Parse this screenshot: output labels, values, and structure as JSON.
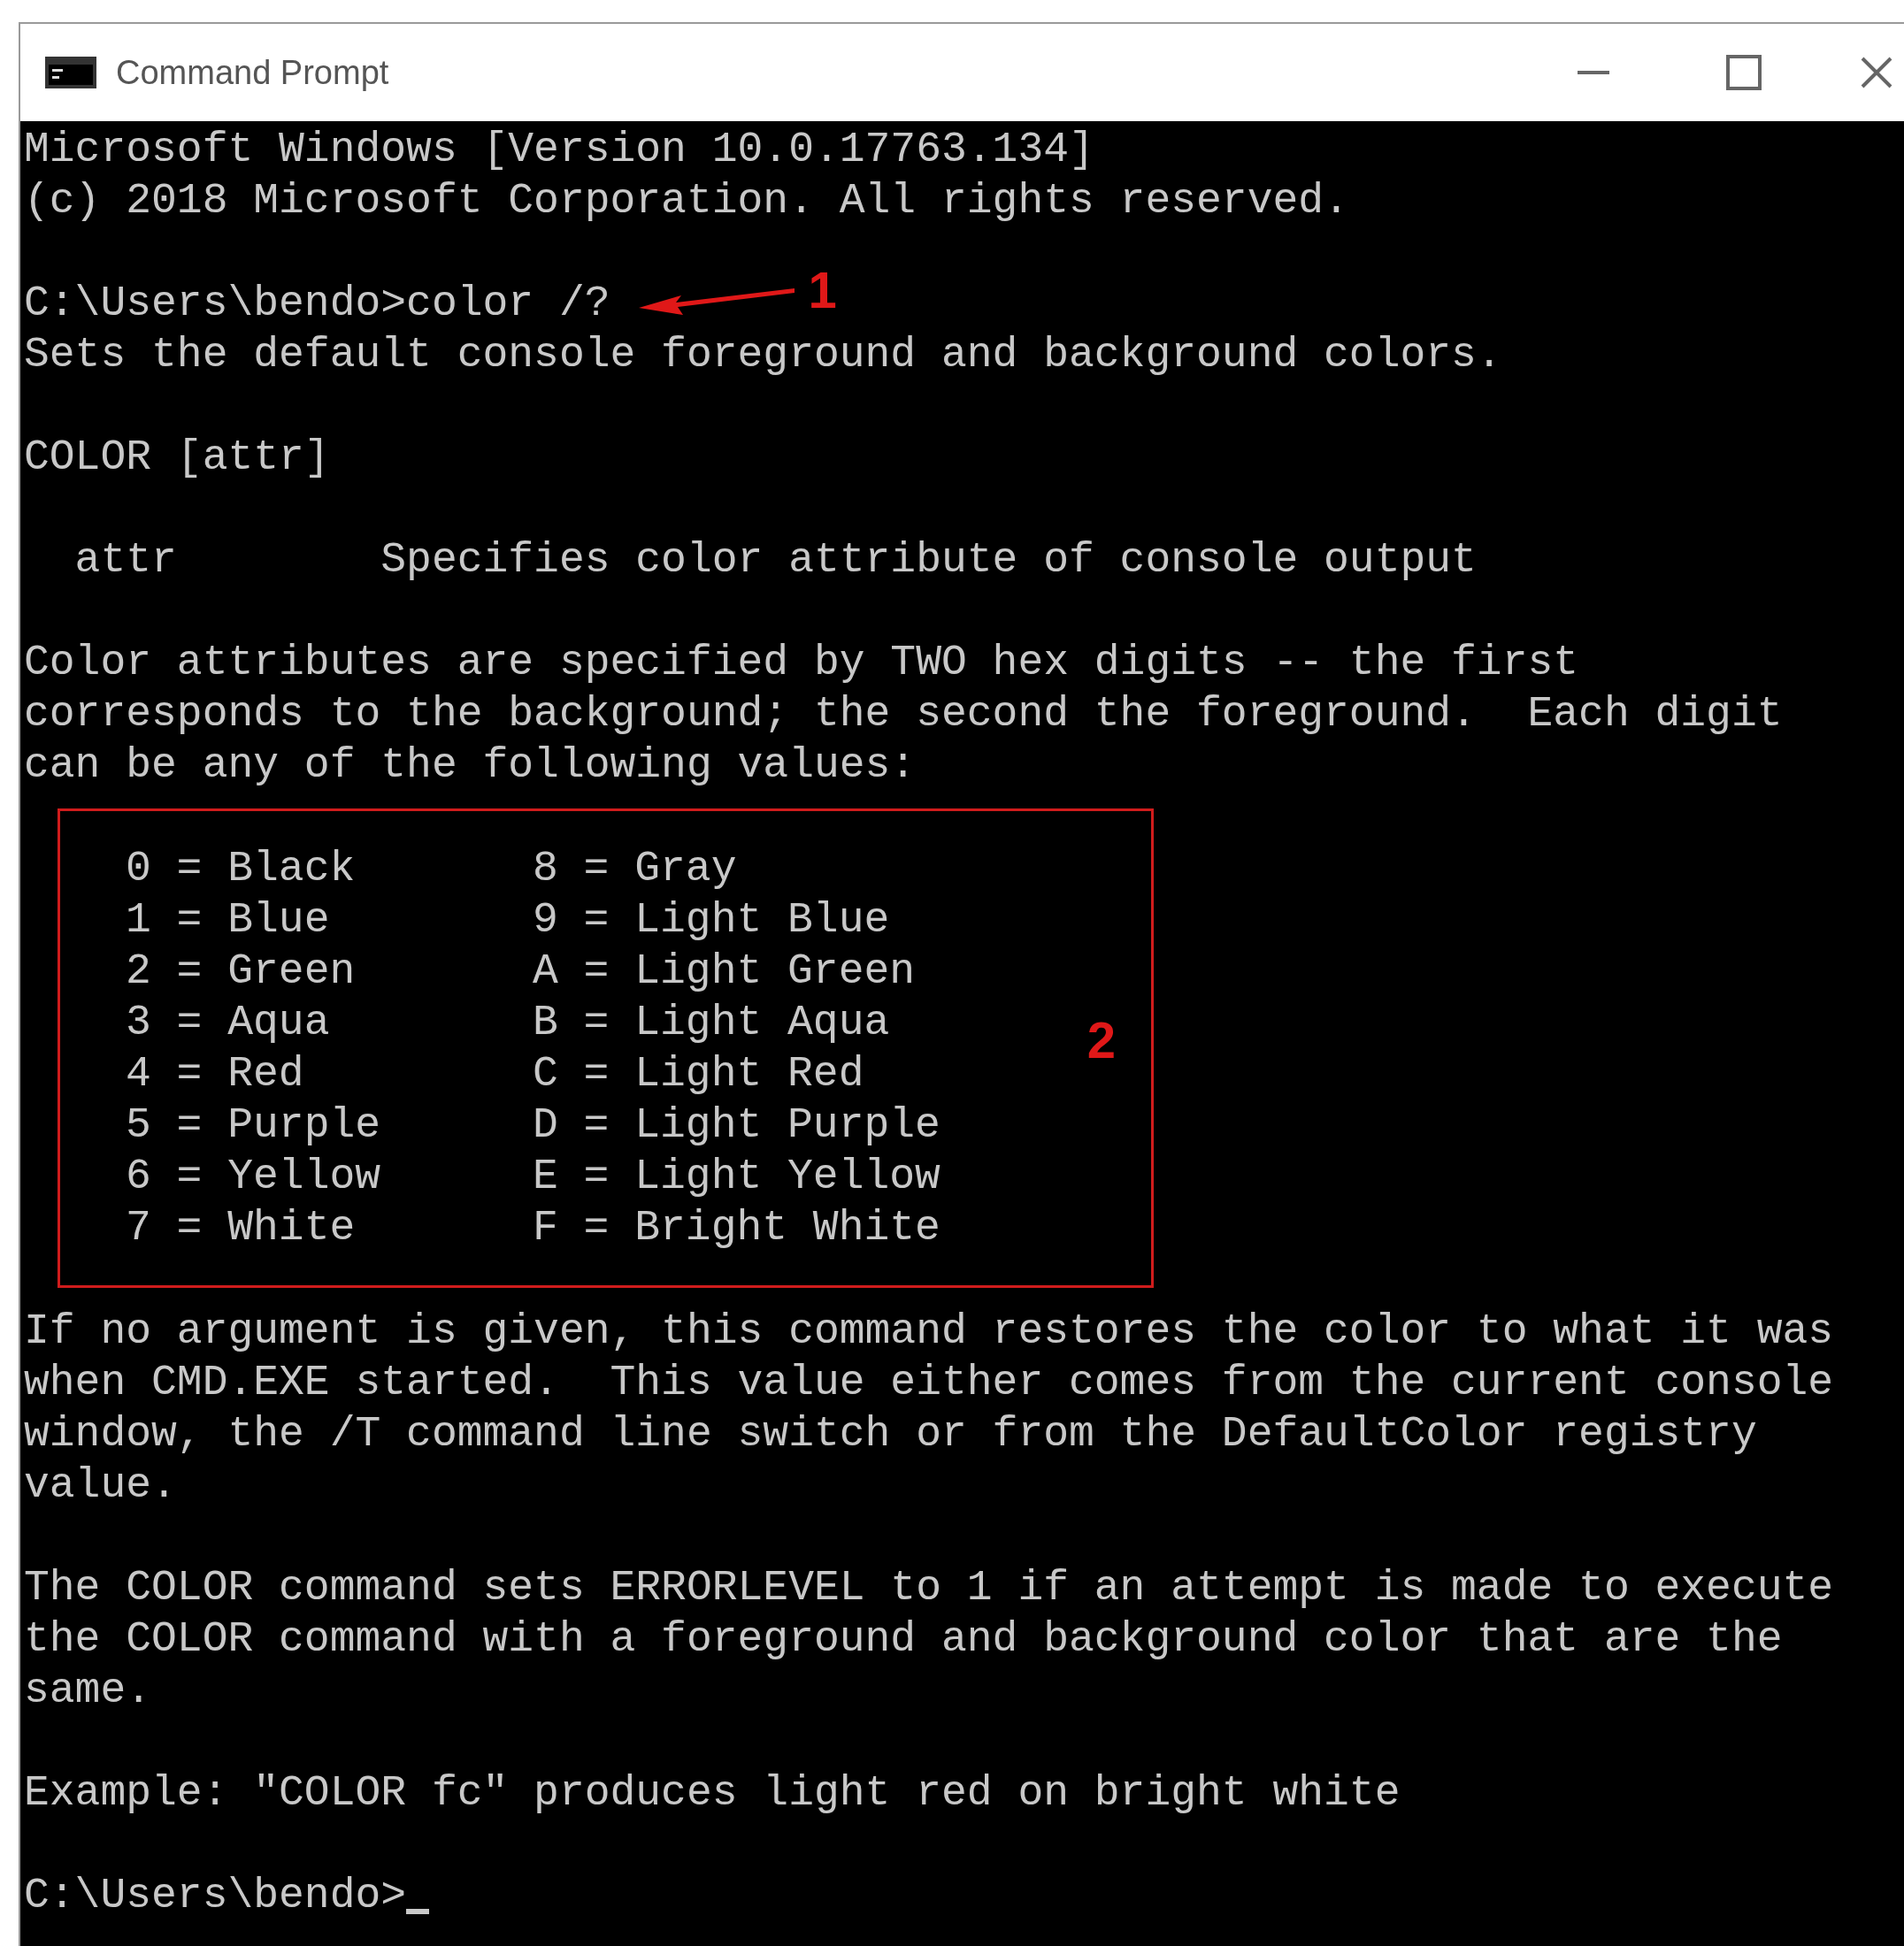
{
  "window": {
    "title": "Command Prompt"
  },
  "console": {
    "lines": [
      {
        "kind": "text",
        "text": "Microsoft Windows [Version 10.0.17763.134]"
      },
      {
        "kind": "text",
        "text": "(c) 2018 Microsoft Corporation. All rights reserved."
      },
      {
        "kind": "blank"
      },
      {
        "kind": "command",
        "prompt": "C:\\Users\\bendo>",
        "command": "color /?",
        "annotation": "1"
      },
      {
        "kind": "text",
        "text": "Sets the default console foreground and background colors."
      },
      {
        "kind": "blank"
      },
      {
        "kind": "text",
        "text": "COLOR [attr]"
      },
      {
        "kind": "blank"
      },
      {
        "kind": "text",
        "text": "  attr        Specifies color attribute of console output"
      },
      {
        "kind": "blank"
      },
      {
        "kind": "text",
        "text": "Color attributes are specified by TWO hex digits -- the first"
      },
      {
        "kind": "text",
        "text": "corresponds to the background; the second the foreground.  Each digit"
      },
      {
        "kind": "text",
        "text": "can be any of the following values:"
      },
      {
        "kind": "color_table",
        "annotation": "2",
        "entries": [
          {
            "left": "0 = Black",
            "right": "8 = Gray"
          },
          {
            "left": "1 = Blue",
            "right": "9 = Light Blue"
          },
          {
            "left": "2 = Green",
            "right": "A = Light Green"
          },
          {
            "left": "3 = Aqua",
            "right": "B = Light Aqua"
          },
          {
            "left": "4 = Red",
            "right": "C = Light Red"
          },
          {
            "left": "5 = Purple",
            "right": "D = Light Purple"
          },
          {
            "left": "6 = Yellow",
            "right": "E = Light Yellow"
          },
          {
            "left": "7 = White",
            "right": "F = Bright White"
          }
        ]
      },
      {
        "kind": "text",
        "text": "If no argument is given, this command restores the color to what it was"
      },
      {
        "kind": "text",
        "text": "when CMD.EXE started.  This value either comes from the current console"
      },
      {
        "kind": "text",
        "text": "window, the /T command line switch or from the DefaultColor registry"
      },
      {
        "kind": "text",
        "text": "value."
      },
      {
        "kind": "blank"
      },
      {
        "kind": "text",
        "text": "The COLOR command sets ERRORLEVEL to 1 if an attempt is made to execute"
      },
      {
        "kind": "text",
        "text": "the COLOR command with a foreground and background color that are the"
      },
      {
        "kind": "text",
        "text": "same."
      },
      {
        "kind": "blank"
      },
      {
        "kind": "text",
        "text": "Example: \"COLOR fc\" produces light red on bright white"
      },
      {
        "kind": "blank"
      },
      {
        "kind": "input",
        "prompt": "C:\\Users\\bendo>"
      }
    ]
  }
}
